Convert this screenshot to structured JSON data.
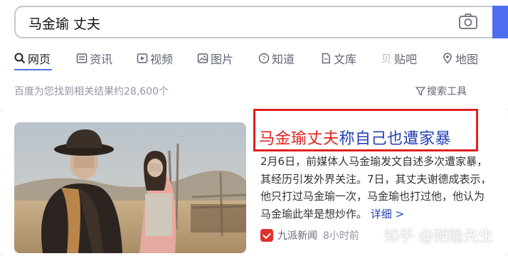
{
  "search": {
    "query": "马金瑜 丈夫"
  },
  "tabs": [
    {
      "label": "网页",
      "icon": "search-icon",
      "active": true
    },
    {
      "label": "资讯",
      "icon": "news-icon"
    },
    {
      "label": "视频",
      "icon": "video-icon"
    },
    {
      "label": "图片",
      "icon": "image-icon"
    },
    {
      "label": "知道",
      "icon": "question-icon"
    },
    {
      "label": "文库",
      "icon": "document-icon"
    },
    {
      "label": "贴吧",
      "icon": "tieba-icon"
    },
    {
      "label": "地图",
      "icon": "map-icon"
    }
  ],
  "result_count": "百度为您找到相关结果约28,600个",
  "search_tools": "搜索工具",
  "result": {
    "title_highlight": "马金瑜丈夫",
    "title_rest": "称自己也遭家暴",
    "snippet": "2月6日，前媒体人马金瑜发文自述多次遭家暴，其经历引发外界关注。7日，其丈夫谢德成表示，他只打过马金瑜一次，马金瑜也打过他，他认为马金瑜此举是想炒作。",
    "more_link": "详细 >",
    "source": "九派新闻",
    "time": "8小时前"
  },
  "watermark": "知乎 @朔隐先生",
  "colors": {
    "accent": "#4e6ef2",
    "highlight": "#e02020",
    "link": "#2440b3"
  }
}
